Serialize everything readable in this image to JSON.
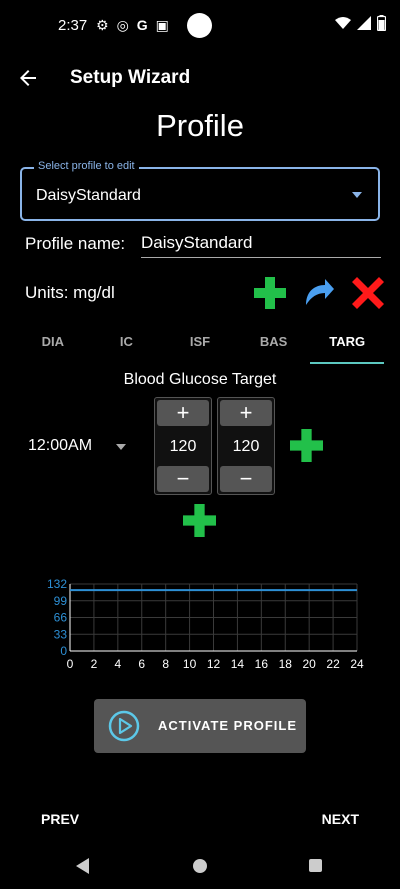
{
  "status_bar": {
    "time": "2:37",
    "icons_left": [
      "⚙",
      "◎",
      "G",
      "▣"
    ],
    "icons_right": [
      "wifi-icon",
      "signal-icon",
      "battery-icon"
    ]
  },
  "app_bar": {
    "title": "Setup Wizard"
  },
  "page": {
    "title": "Profile"
  },
  "profile_select": {
    "label": "Select profile to edit",
    "value": "DaisyStandard"
  },
  "profile_name": {
    "label": "Profile name:",
    "value": "DaisyStandard"
  },
  "units": {
    "label": "Units: mg/dl"
  },
  "tabs": [
    {
      "label": "DIA"
    },
    {
      "label": "IC"
    },
    {
      "label": "ISF"
    },
    {
      "label": "BAS"
    },
    {
      "label": "TARG",
      "active": true
    }
  ],
  "target": {
    "title": "Blood Glucose Target",
    "time": "12:00AM",
    "low": {
      "plus": "+",
      "value": "120",
      "minus": "−"
    },
    "high": {
      "plus": "+",
      "value": "120",
      "minus": "−"
    }
  },
  "chart_data": {
    "type": "line",
    "x_ticks": [
      "0",
      "2",
      "4",
      "6",
      "8",
      "10",
      "12",
      "14",
      "16",
      "18",
      "20",
      "22",
      "24"
    ],
    "y_ticks": [
      "0",
      "33",
      "66",
      "99",
      "132"
    ],
    "xlim": [
      0,
      24
    ],
    "ylim": [
      0,
      132
    ],
    "grid": true,
    "series": [
      {
        "color": "#2d8fd4",
        "x": [
          0,
          24
        ],
        "y": [
          120,
          120
        ]
      }
    ]
  },
  "activate_button": {
    "label": "ACTIVATE PROFILE"
  },
  "footer": {
    "prev": "PREV",
    "next": "NEXT"
  },
  "colors": {
    "accent": "#8ab4e8",
    "add_green": "#22c04a",
    "delete_red": "#ff1a1a",
    "clone_blue": "#4a9ff0",
    "tab_indicator": "#5cc8c0"
  }
}
